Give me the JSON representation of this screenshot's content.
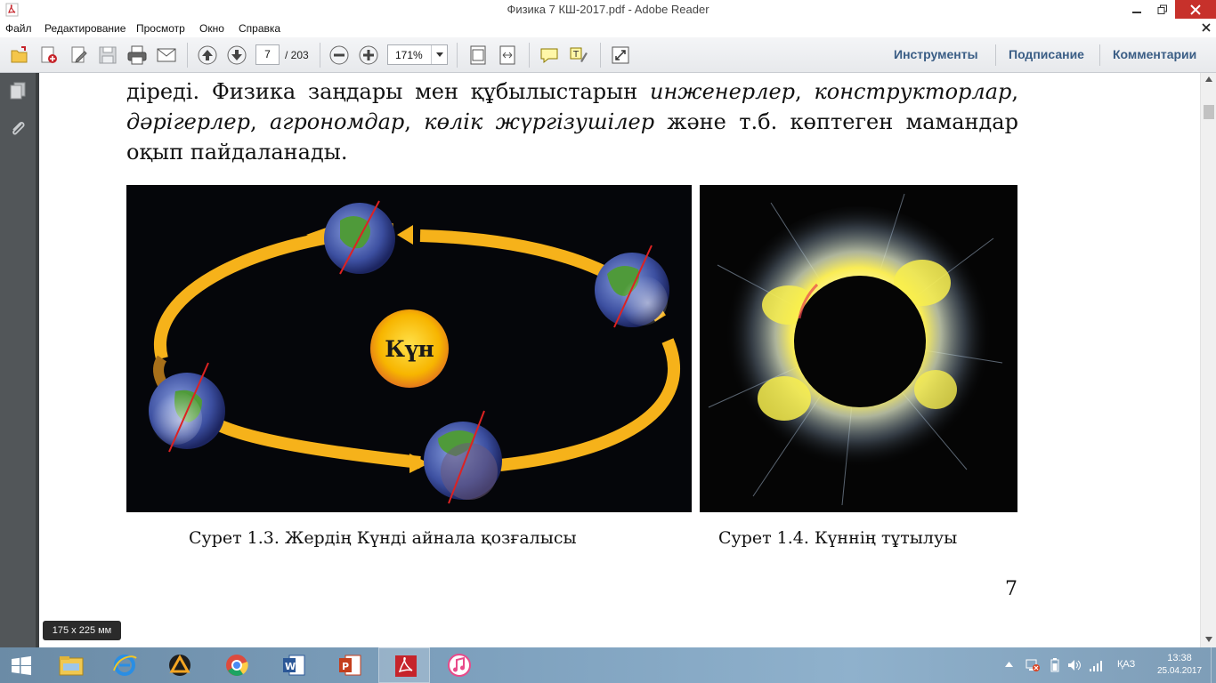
{
  "window": {
    "title": "Физика 7 КШ-2017.pdf - Adobe Reader"
  },
  "menu": {
    "items": [
      "Файл",
      "Редактирование",
      "Просмотр",
      "Окно",
      "Справка"
    ]
  },
  "toolbar": {
    "page_current": "7",
    "page_total": "/ 203",
    "zoom": "171%",
    "right_tabs": [
      "Инструменты",
      "Подписание",
      "Комментарии"
    ],
    "icons": [
      "open-icon",
      "create-pdf-icon",
      "edit-icon",
      "save-icon",
      "print-icon",
      "email-icon",
      "page-up-icon",
      "page-down-icon",
      "zoom-out-icon",
      "zoom-in-icon",
      "fit-page-icon",
      "fit-width-icon",
      "comment-icon",
      "highlight-icon",
      "fullscreen-icon"
    ]
  },
  "document": {
    "line1_a": "діреді. Физика заңдары мен құбылыстарын ",
    "line1_i1": "инженерлер",
    "line1_b": ", ",
    "line1_i2": "конструкторлар",
    "line1_c": ",",
    "line2_i1": "дәрігерлер",
    "line2_a": ", ",
    "line2_i2": "агрономдар",
    "line2_b": ", ",
    "line2_i3": "көлік жүргізушілер",
    "line2_c": " және т.б. көптеген мамандар",
    "line3": "оқып пайдаланады.",
    "fig1_label": "Күн",
    "caption1": "Сурет 1.3. Жердің Күнді айнала қозғалысы",
    "caption2": "Сурет 1.4. Күннің тұтылуы",
    "page_number": "7"
  },
  "page_size": "175 x 225 мм",
  "taskbar": {
    "apps": [
      "file-explorer-icon",
      "internet-explorer-icon",
      "aimp-icon",
      "chrome-icon",
      "word-icon",
      "powerpoint-icon",
      "adobe-reader-icon",
      "itunes-icon"
    ],
    "active_index": 6,
    "language": "ҚАЗ",
    "time": "13:38",
    "date": "25.04.2017"
  },
  "colors": {
    "toolbar_tab_text": "#3a5d85",
    "close_button": "#c7312b",
    "taskbar": "#7ea1be",
    "sun": "#f7b500",
    "orbit_arrow": "#f6b21a"
  }
}
